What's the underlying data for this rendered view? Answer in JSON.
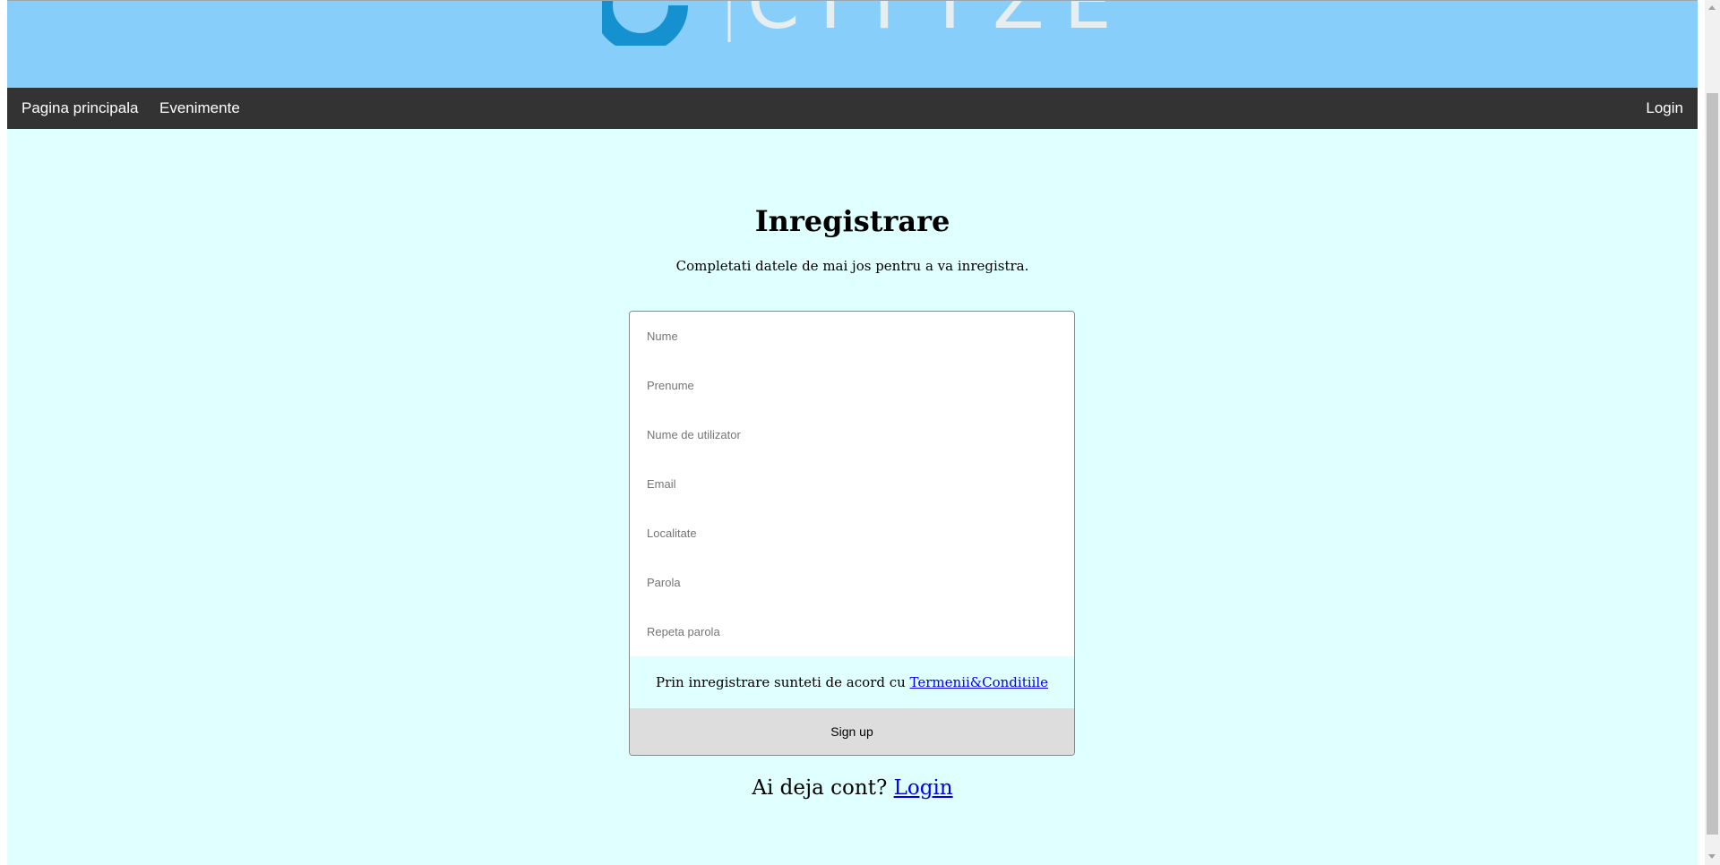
{
  "banner": {
    "logo_text": "CITYZEN",
    "logo_icon": "c-logo-icon",
    "colors": {
      "banner_bg": "#87cefa",
      "logo_blue": "#1591d0",
      "logo_text": "#e6eef2"
    }
  },
  "nav": {
    "home_label": "Pagina principala",
    "events_label": "Evenimente",
    "login_label": "Login",
    "bg_color": "#333333"
  },
  "main": {
    "title": "Inregistrare",
    "subtitle": "Completati datele de mai jos pentru a va inregistra.",
    "bg_color": "#e0ffff"
  },
  "form": {
    "fields": [
      {
        "placeholder": "Nume",
        "value": ""
      },
      {
        "placeholder": "Prenume",
        "value": ""
      },
      {
        "placeholder": "Nume de utilizator",
        "value": ""
      },
      {
        "placeholder": "Email",
        "value": ""
      },
      {
        "placeholder": "Localitate",
        "value": ""
      },
      {
        "placeholder": "Parola",
        "value": ""
      },
      {
        "placeholder": "Repeta parola",
        "value": ""
      }
    ],
    "terms_text": "Prin inregistrare sunteti de acord cu ",
    "terms_link": "Termenii&Conditiile",
    "signup_label": "Sign up"
  },
  "footer": {
    "question": "Ai deja cont? ",
    "login_link": "Login"
  }
}
